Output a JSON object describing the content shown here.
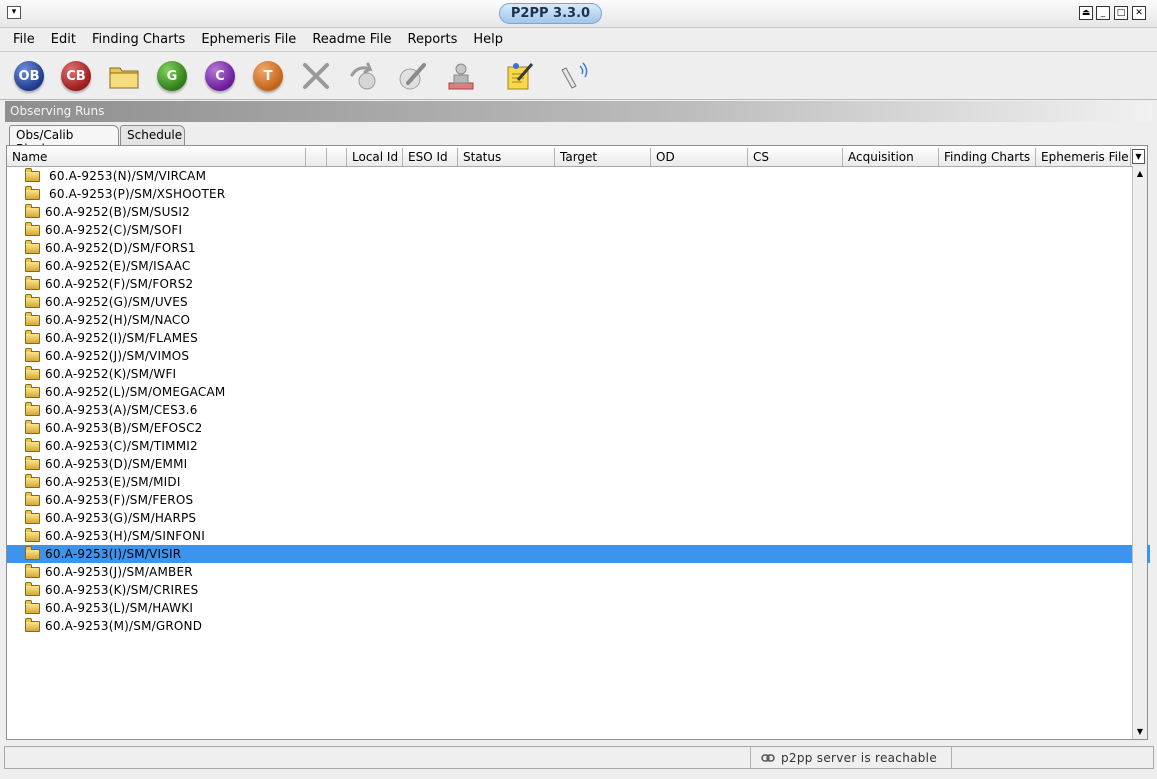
{
  "window": {
    "title": "P2PP 3.3.0",
    "sysmenu_glyph": "▾",
    "buttons": [
      "⏏",
      "_",
      "□",
      "✕"
    ]
  },
  "menus": [
    "File",
    "Edit",
    "Finding Charts",
    "Ephemeris File",
    "Readme File",
    "Reports",
    "Help"
  ],
  "toolbar": {
    "ob": {
      "label": "OB",
      "color": "#1e3a8a"
    },
    "cb": {
      "label": "CB",
      "color": "#9b1c1c"
    },
    "g": {
      "label": "G",
      "color": "#2f7d1a"
    },
    "c": {
      "label": "C",
      "color": "#6a1b9a"
    },
    "t": {
      "label": "T",
      "color": "#c2631a"
    }
  },
  "panel_title": "Observing Runs",
  "tabs": [
    "Obs/Calib Blocks",
    "Schedule"
  ],
  "columns": [
    "Name",
    "",
    "",
    "Local Id",
    "ESO Id",
    "Status",
    "Target",
    "OD",
    "CS",
    "Acquisition",
    "Finding Charts",
    "Ephemeris File"
  ],
  "rows": [
    "60.A-9253(N)/SM/VIRCAM",
    "60.A-9253(P)/SM/XSHOOTER",
    "60.A-9252(B)/SM/SUSI2",
    "60.A-9252(C)/SM/SOFI",
    "60.A-9252(D)/SM/FORS1",
    "60.A-9252(E)/SM/ISAAC",
    "60.A-9252(F)/SM/FORS2",
    "60.A-9252(G)/SM/UVES",
    "60.A-9252(H)/SM/NACO",
    "60.A-9252(I)/SM/FLAMES",
    "60.A-9252(J)/SM/VIMOS",
    "60.A-9252(K)/SM/WFI",
    "60.A-9252(L)/SM/OMEGACAM",
    "60.A-9253(A)/SM/CES3.6",
    "60.A-9253(B)/SM/EFOSC2",
    "60.A-9253(C)/SM/TIMMI2",
    "60.A-9253(D)/SM/EMMI",
    "60.A-9253(E)/SM/MIDI",
    "60.A-9253(F)/SM/FEROS",
    "60.A-9253(G)/SM/HARPS",
    "60.A-9253(H)/SM/SINFONI",
    "60.A-9253(I)/SM/VISIR",
    "60.A-9253(J)/SM/AMBER",
    "60.A-9253(K)/SM/CRIRES",
    "60.A-9253(L)/SM/HAWKI",
    "60.A-9253(M)/SM/GROND"
  ],
  "selected_row": "60.A-9253(I)/SM/VISIR",
  "status": {
    "message": "p2pp server is reachable"
  },
  "colors": {
    "selection": "#3d94ec",
    "title_pill": "#9fc6ea"
  }
}
